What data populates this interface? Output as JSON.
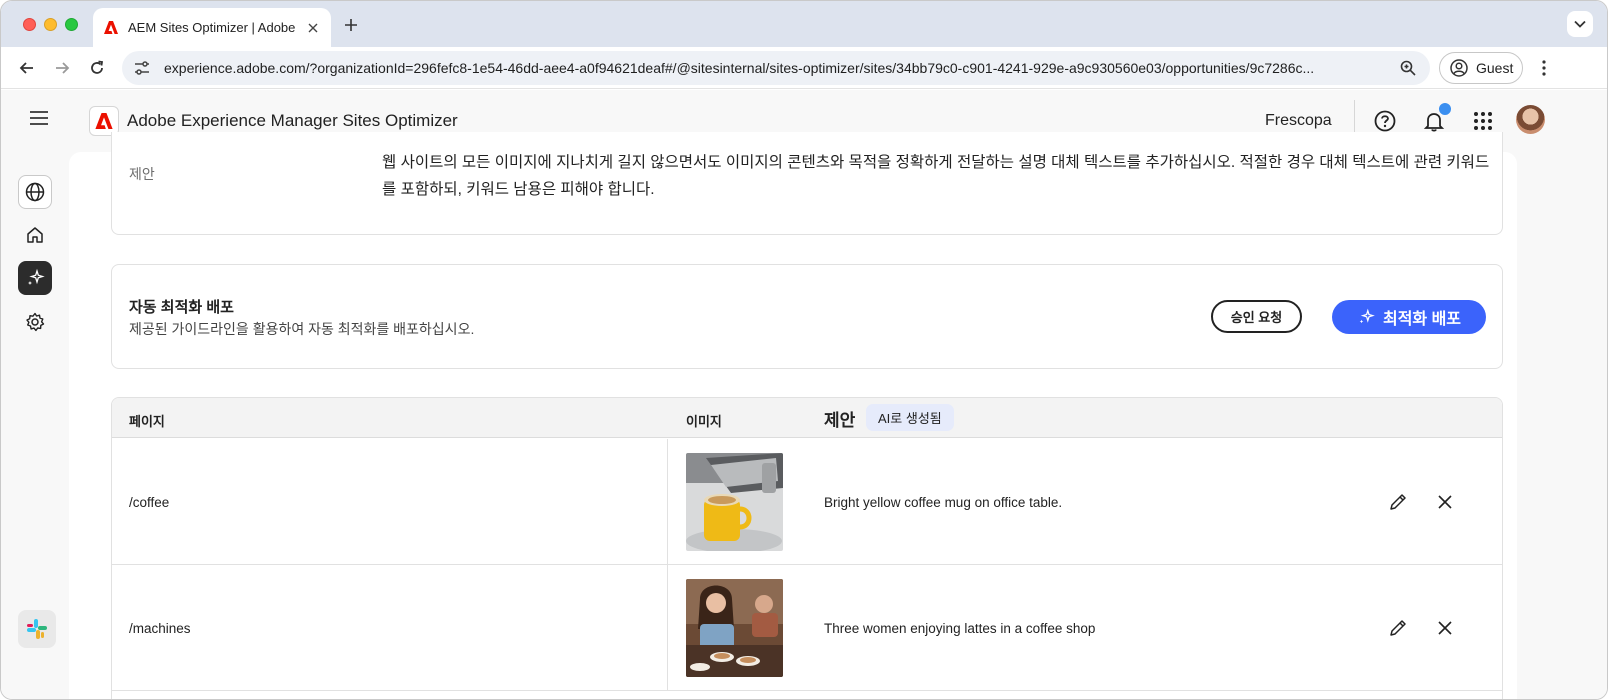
{
  "browser": {
    "tab_title": "AEM Sites Optimizer | Adobe",
    "url_host": "experience.adobe.com",
    "url_rest": "/?organizationId=296fefc8-1e54-46dd-aee4-a0f94621deaf#/@sitesinternal/sites-optimizer/sites/34bb79c0-c901-4241-929e-a9c930560e03/opportunities/9c7286c...",
    "profile_label": "Guest"
  },
  "app": {
    "title": "Adobe Experience Manager Sites Optimizer",
    "org_name": "Frescopa"
  },
  "suggestion_card": {
    "label": "제안",
    "text": "웹 사이트의 모든 이미지에 지나치게 길지 않으면서도 이미지의 콘텐츠와 목적을 정확하게 전달하는 설명 대체 텍스트를 추가하십시오. 적절한 경우 대체 텍스트에 관련 키워드를 포함하되, 키워드 남용은 피해야 합니다."
  },
  "deploy_card": {
    "title": "자동 최적화 배포",
    "subtitle": "제공된 가이드라인을 활용하여 자동 최적화를 배포하십시오.",
    "request_approval_label": "승인 요청",
    "deploy_label": "최적화 배포"
  },
  "table": {
    "col_page": "페이지",
    "col_image": "이미지",
    "col_suggestion": "제안",
    "ai_badge": "AI로 생성됨",
    "rows": [
      {
        "page": "/coffee",
        "suggestion": "Bright yellow coffee mug on office table."
      },
      {
        "page": "/machines",
        "suggestion": "Three women enjoying lattes in a coffee shop"
      }
    ]
  },
  "colors": {
    "accent": "#3b63fb",
    "adobe_red": "#eb1000",
    "notification": "#3b8ff0"
  }
}
